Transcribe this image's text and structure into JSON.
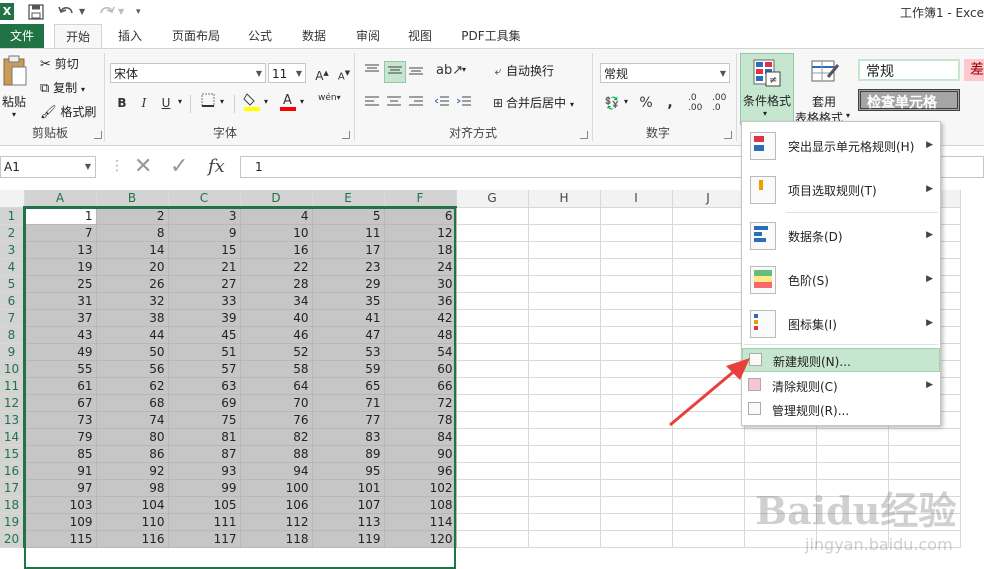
{
  "app": {
    "logo": "X",
    "document_title": "工作簿1 - Exce"
  },
  "qat": {
    "save_icon": "save-icon",
    "undo_icon": "undo-icon",
    "redo_icon": "redo-icon",
    "customize_icon": "customize-icon"
  },
  "tabs": [
    "文件",
    "开始",
    "插入",
    "页面布局",
    "公式",
    "数据",
    "审阅",
    "视图",
    "PDF工具集"
  ],
  "ribbon": {
    "clipboard": {
      "paste": "粘贴",
      "cut": "剪切",
      "copy": "复制",
      "format_painter": "格式刷",
      "group_label": "剪贴板"
    },
    "font": {
      "font_name": "宋体",
      "font_size": "11",
      "bold": "B",
      "italic": "I",
      "underline": "U",
      "grow": "A",
      "shrink": "A",
      "fill_color": "#ffff00",
      "font_color": "#ff0000",
      "phonetic": "wén",
      "group_label": "字体"
    },
    "alignment": {
      "wrap_text": "自动换行",
      "merge_center": "合并后居中",
      "group_label": "对齐方式"
    },
    "number": {
      "format": "常规",
      "percent": "%",
      "comma": ",",
      "inc_decimal": ".00",
      "dec_decimal": ".0",
      "group_label": "数字"
    },
    "styles": {
      "conditional_formatting": "条件格式",
      "format_as_table_line1": "套用",
      "format_as_table_line2": "表格格式",
      "style_normal": "常规",
      "style_check_cell": "检查单元格",
      "style_bad": "差"
    }
  },
  "formula_bar": {
    "name_box": "A1",
    "cancel": "✕",
    "enter": "✓",
    "fx": "fx",
    "content": "1"
  },
  "sheet": {
    "columns": [
      "A",
      "B",
      "C",
      "D",
      "E",
      "F",
      "G",
      "H",
      "I",
      "J"
    ],
    "rows": [
      [
        "1",
        "2",
        "3",
        "4",
        "5",
        "6"
      ],
      [
        "7",
        "8",
        "9",
        "10",
        "11",
        "12"
      ],
      [
        "13",
        "14",
        "15",
        "16",
        "17",
        "18"
      ],
      [
        "19",
        "20",
        "21",
        "22",
        "23",
        "24"
      ],
      [
        "25",
        "26",
        "27",
        "28",
        "29",
        "30"
      ],
      [
        "31",
        "32",
        "33",
        "34",
        "35",
        "36"
      ],
      [
        "37",
        "38",
        "39",
        "40",
        "41",
        "42"
      ],
      [
        "43",
        "44",
        "45",
        "46",
        "47",
        "48"
      ],
      [
        "49",
        "50",
        "51",
        "52",
        "53",
        "54"
      ],
      [
        "55",
        "56",
        "57",
        "58",
        "59",
        "60"
      ],
      [
        "61",
        "62",
        "63",
        "64",
        "65",
        "66"
      ],
      [
        "67",
        "68",
        "69",
        "70",
        "71",
        "72"
      ],
      [
        "73",
        "74",
        "75",
        "76",
        "77",
        "78"
      ],
      [
        "79",
        "80",
        "81",
        "82",
        "83",
        "84"
      ],
      [
        "85",
        "86",
        "87",
        "88",
        "89",
        "90"
      ],
      [
        "91",
        "92",
        "93",
        "94",
        "95",
        "96"
      ],
      [
        "97",
        "98",
        "99",
        "100",
        "101",
        "102"
      ],
      [
        "103",
        "104",
        "105",
        "106",
        "107",
        "108"
      ],
      [
        "109",
        "110",
        "111",
        "112",
        "113",
        "114"
      ],
      [
        "115",
        "116",
        "117",
        "118",
        "119",
        "120"
      ]
    ]
  },
  "cf_menu": {
    "items": [
      {
        "label": "突出显示单元格规则(H)",
        "icon": "highlight-rules-icon",
        "submenu": true
      },
      {
        "label": "项目选取规则(T)",
        "icon": "top-bottom-rules-icon",
        "submenu": true
      },
      {
        "label": "数据条(D)",
        "icon": "data-bars-icon",
        "submenu": true
      },
      {
        "label": "色阶(S)",
        "icon": "color-scales-icon",
        "submenu": true
      },
      {
        "label": "图标集(I)",
        "icon": "icon-sets-icon",
        "submenu": true
      },
      {
        "label": "新建规则(N)...",
        "icon": "new-rule-icon",
        "submenu": false
      },
      {
        "label": "清除规则(C)",
        "icon": "clear-rules-icon",
        "submenu": true
      },
      {
        "label": "管理规则(R)...",
        "icon": "manage-rules-icon",
        "submenu": false
      }
    ],
    "highlighted_index": 5
  },
  "colors": {
    "excel_green": "#217346",
    "selection_gray": "#c6c6c6",
    "hover_green": "#c6e6cf",
    "arrow_red": "#e8403a"
  },
  "watermark": {
    "brand": "Baidu经验",
    "url": "jingyan.baidu.com"
  }
}
